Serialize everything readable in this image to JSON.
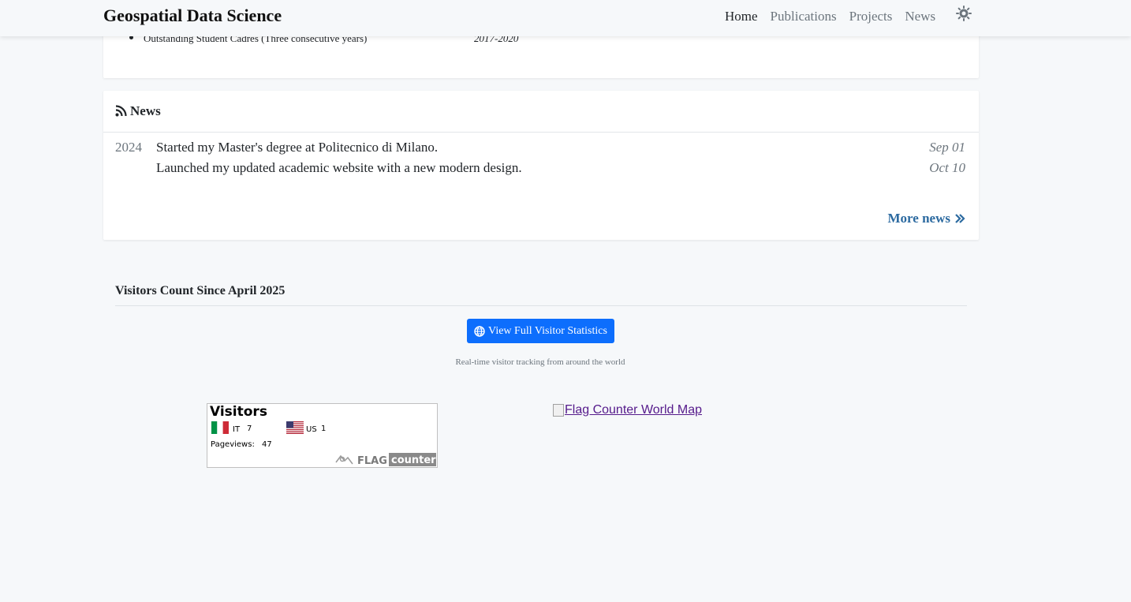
{
  "nav": {
    "brand": "Geospatial Data Science",
    "links": [
      "Home",
      "Publications",
      "Projects",
      "News"
    ],
    "active": "Home",
    "theme_icon": "sun-icon"
  },
  "awards": {
    "item": "Outstanding Student Cadres (Three consecutive years)",
    "years": "2017-2020"
  },
  "news": {
    "title": "News",
    "year": "2024",
    "items": [
      {
        "text": "Started my Master's degree at Politecnico di Milano.",
        "date": "Sep 01"
      },
      {
        "text": "Launched my updated academic website with a new modern design.",
        "date": "Oct 10"
      }
    ],
    "more_label": "More news"
  },
  "visitors": {
    "title": "Visitors Count Since April 2025",
    "button_label": "View Full Visitor Statistics",
    "note": "Real-time visitor tracking from around the world",
    "counter": {
      "heading": "Visitors",
      "countries": [
        {
          "code": "IT",
          "count": "7"
        },
        {
          "code": "US",
          "count": "1"
        }
      ],
      "pageviews_label": "Pageviews:",
      "pageviews": "47",
      "logo_text": "FLAG counter"
    },
    "map_alt": "Flag Counter World Map"
  },
  "colors": {
    "accent": "#0d6efd",
    "link": "#2c6aa0",
    "background": "#f6f8fa"
  }
}
